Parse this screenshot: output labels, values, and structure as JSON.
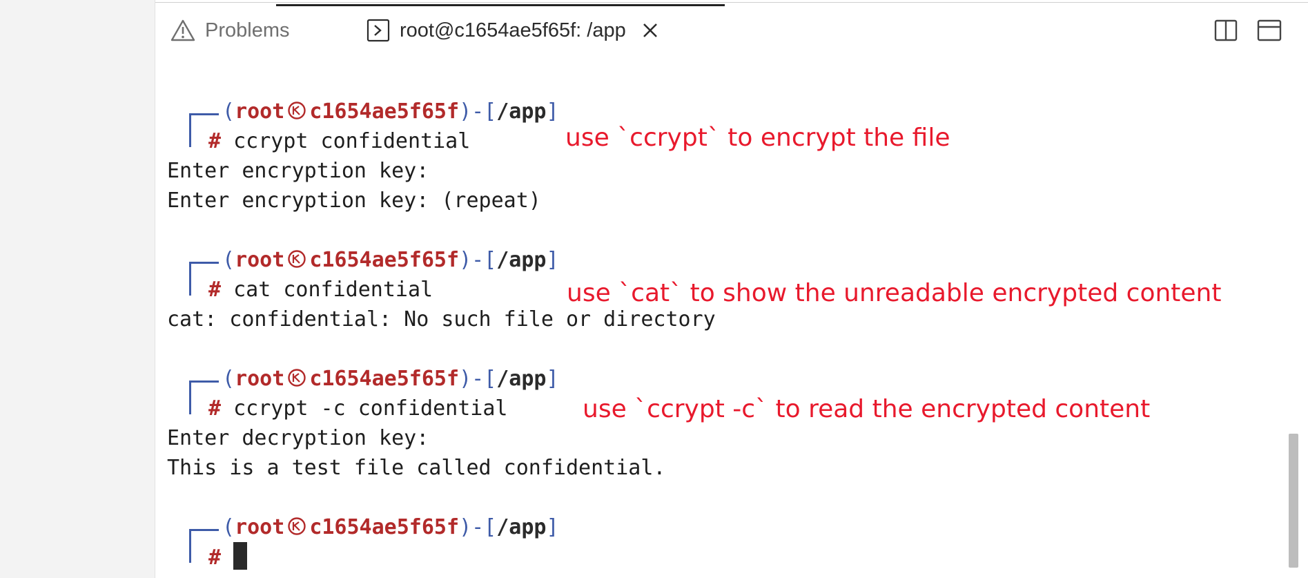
{
  "tabs": {
    "problems_label": "Problems",
    "terminal_label": "root@c1654ae5f65f: /app"
  },
  "toolbar": {
    "split_icon": "split-editor-icon",
    "maximize_icon": "maximize-panel-icon"
  },
  "prompt": {
    "user": "root",
    "host": "c1654ae5f65f",
    "path": "/app",
    "hash": "#"
  },
  "terminal": {
    "cmd1": "ccrypt confidential",
    "out1a": "Enter encryption key:",
    "out1b": "Enter encryption key: (repeat)",
    "cmd2": "cat confidential",
    "out2": "cat: confidential: No such file or directory",
    "cmd3": "ccrypt -c confidential",
    "out3a": "Enter decryption key:",
    "out3b": "This is a test file called confidential."
  },
  "annotations": {
    "a1": "use `ccrypt` to encrypt the file",
    "a2": "use `cat` to show the unreadable encrypted content",
    "a3": "use `ccrypt -c` to read the encrypted content"
  },
  "colors": {
    "prompt_blue": "#3e5ba8",
    "prompt_red": "#b22a2a",
    "annotation_red": "#e8192c"
  }
}
